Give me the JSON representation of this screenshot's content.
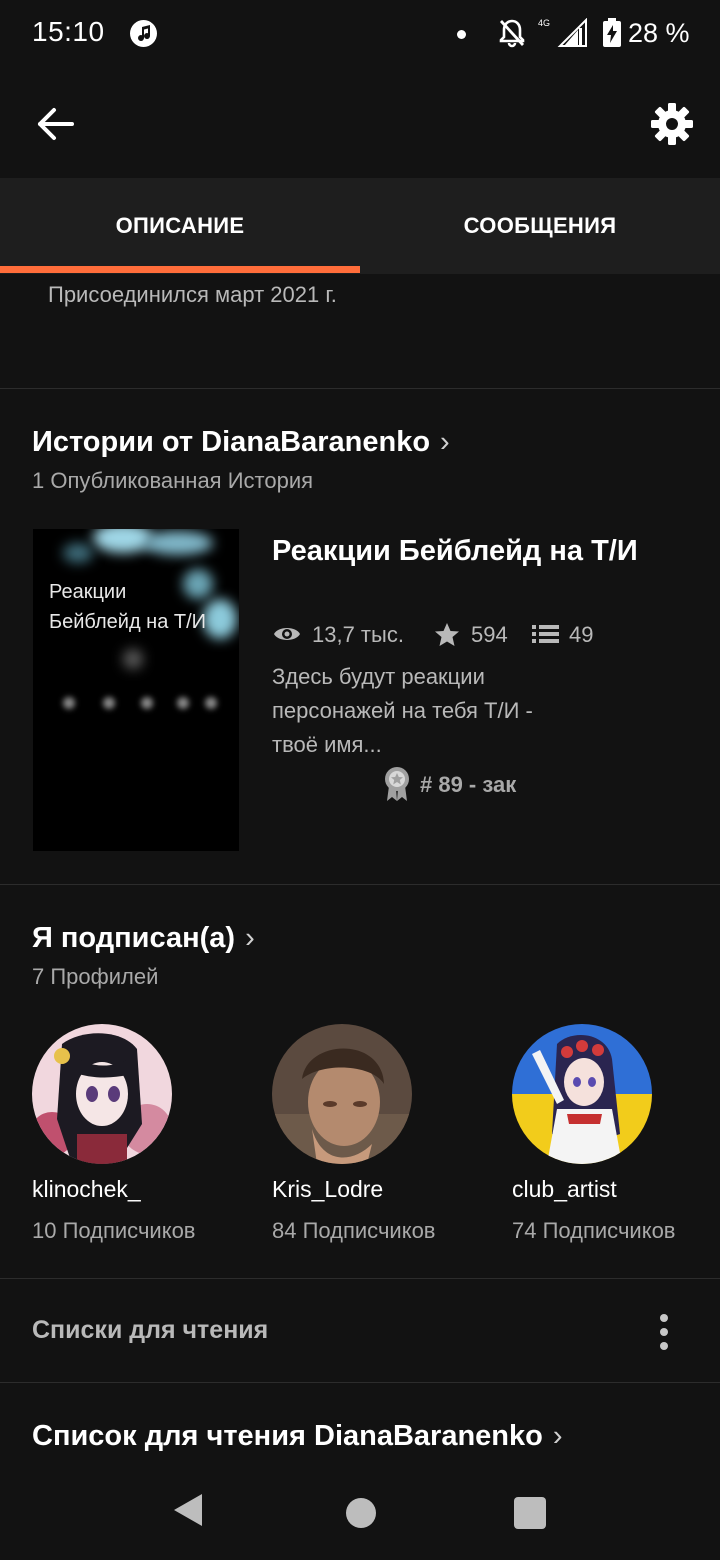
{
  "status_bar": {
    "time": "15:10",
    "network": "4G",
    "battery": "28 %"
  },
  "tabs": [
    {
      "label": "ОПИСАНИЕ",
      "selected": true
    },
    {
      "label": "СООБЩЕНИЯ",
      "selected": false
    }
  ],
  "joined_text": "Присоединился март 2021 г.",
  "stories": {
    "title": "Истории от DianaBaranenko",
    "subtitle": "1 Опубликованная История",
    "item": {
      "cover_text": "Реакции Бейблейд на Т/И",
      "title": "Реакции Бейблейд на Т/И",
      "views": "13,7 тыс.",
      "votes": "594",
      "parts": "49",
      "description": "Здесь будут реакции персонажей на тебя Т/И - твоё имя...",
      "rank": "# 89 - зак"
    }
  },
  "following": {
    "title": "Я подписан(а)",
    "subtitle": "7 Профилей",
    "profiles": [
      {
        "name": "klinochek_",
        "followers": "10 Подписчиков"
      },
      {
        "name": "Kris_Lodre",
        "followers": "84 Подписчиков"
      },
      {
        "name": "club_artist",
        "followers": "74 Подписчиков"
      }
    ]
  },
  "reading_lists": {
    "header": "Списки для чтения",
    "list_title": "Список для чтения DianaBaranenko"
  },
  "colors": {
    "accent": "#ff6d3a",
    "background": "#121212",
    "tab_bar": "#1e1e1e"
  },
  "icons": [
    "back-arrow-icon",
    "gear-icon",
    "eye-icon",
    "star-icon",
    "list-icon",
    "rank-ribbon-icon",
    "more-vertical-icon",
    "chevron-right-icon"
  ]
}
